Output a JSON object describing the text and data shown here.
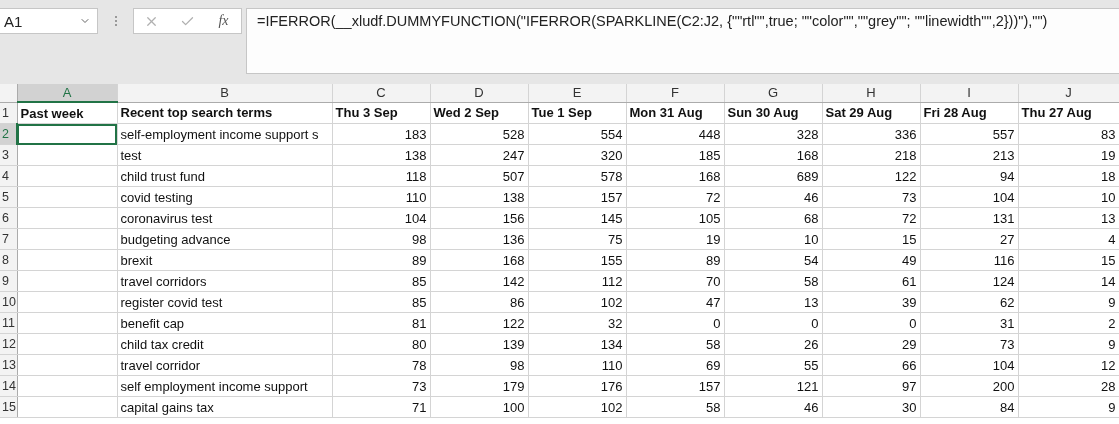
{
  "formula_bar": {
    "name_box": "A1",
    "function_label": "fx",
    "formula": "=IFERROR(__xludf.DUMMYFUNCTION(\"IFERROR(SPARKLINE(C2:J2, {\"\"rtl\"\",true; \"\"color\"\",\"\"grey\"\"; \"\"linewidth\"\",2}))\"),\"\")"
  },
  "columns": [
    {
      "label": "A",
      "selected": true
    },
    {
      "label": "B",
      "selected": false
    },
    {
      "label": "C",
      "selected": false
    },
    {
      "label": "D",
      "selected": false
    },
    {
      "label": "E",
      "selected": false
    },
    {
      "label": "F",
      "selected": false
    },
    {
      "label": "G",
      "selected": false
    },
    {
      "label": "H",
      "selected": false
    },
    {
      "label": "I",
      "selected": false
    },
    {
      "label": "J",
      "selected": false
    }
  ],
  "rows": [
    {
      "number": "1",
      "selected": false,
      "kind": "header",
      "cells": [
        "Past week",
        "Recent top search terms",
        "Thu 3 Sep",
        "Wed 2 Sep",
        "Tue 1 Sep",
        "Mon 31 Aug",
        "Sun 30 Aug",
        "Sat 29 Aug",
        "Fri 28 Aug",
        "Thu 27 Aug"
      ]
    },
    {
      "number": "2",
      "selected": true,
      "kind": "data",
      "cells": [
        "",
        "self-employment income support s",
        "183",
        "528",
        "554",
        "448",
        "328",
        "336",
        "557",
        "83"
      ]
    },
    {
      "number": "3",
      "selected": false,
      "kind": "data",
      "cells": [
        "",
        "test",
        "138",
        "247",
        "320",
        "185",
        "168",
        "218",
        "213",
        "19"
      ]
    },
    {
      "number": "4",
      "selected": false,
      "kind": "data",
      "cells": [
        "",
        "child trust fund",
        "118",
        "507",
        "578",
        "168",
        "689",
        "122",
        "94",
        "18"
      ]
    },
    {
      "number": "5",
      "selected": false,
      "kind": "data",
      "cells": [
        "",
        "covid testing",
        "110",
        "138",
        "157",
        "72",
        "46",
        "73",
        "104",
        "10"
      ]
    },
    {
      "number": "6",
      "selected": false,
      "kind": "data",
      "cells": [
        "",
        "coronavirus test",
        "104",
        "156",
        "145",
        "105",
        "68",
        "72",
        "131",
        "13"
      ]
    },
    {
      "number": "7",
      "selected": false,
      "kind": "data",
      "cells": [
        "",
        "budgeting advance",
        "98",
        "136",
        "75",
        "19",
        "10",
        "15",
        "27",
        "4"
      ]
    },
    {
      "number": "8",
      "selected": false,
      "kind": "data",
      "cells": [
        "",
        "brexit",
        "89",
        "168",
        "155",
        "89",
        "54",
        "49",
        "116",
        "15"
      ]
    },
    {
      "number": "9",
      "selected": false,
      "kind": "data",
      "cells": [
        "",
        "travel corridors",
        "85",
        "142",
        "112",
        "70",
        "58",
        "61",
        "124",
        "14"
      ]
    },
    {
      "number": "10",
      "selected": false,
      "kind": "data",
      "cells": [
        "",
        "register covid test",
        "85",
        "86",
        "102",
        "47",
        "13",
        "39",
        "62",
        "9"
      ]
    },
    {
      "number": "11",
      "selected": false,
      "kind": "data",
      "cells": [
        "",
        "benefit cap",
        "81",
        "122",
        "32",
        "0",
        "0",
        "0",
        "31",
        "2"
      ]
    },
    {
      "number": "12",
      "selected": false,
      "kind": "data",
      "cells": [
        "",
        "child tax credit",
        "80",
        "139",
        "134",
        "58",
        "26",
        "29",
        "73",
        "9"
      ]
    },
    {
      "number": "13",
      "selected": false,
      "kind": "data",
      "cells": [
        "",
        "travel corridor",
        "78",
        "98",
        "110",
        "69",
        "55",
        "66",
        "104",
        "12"
      ]
    },
    {
      "number": "14",
      "selected": false,
      "kind": "data",
      "cells": [
        "",
        "self employment income support",
        "73",
        "179",
        "176",
        "157",
        "121",
        "97",
        "200",
        "28"
      ]
    },
    {
      "number": "15",
      "selected": false,
      "kind": "data",
      "cells": [
        "",
        "capital gains tax",
        "71",
        "100",
        "102",
        "58",
        "46",
        "30",
        "84",
        "9"
      ]
    }
  ]
}
